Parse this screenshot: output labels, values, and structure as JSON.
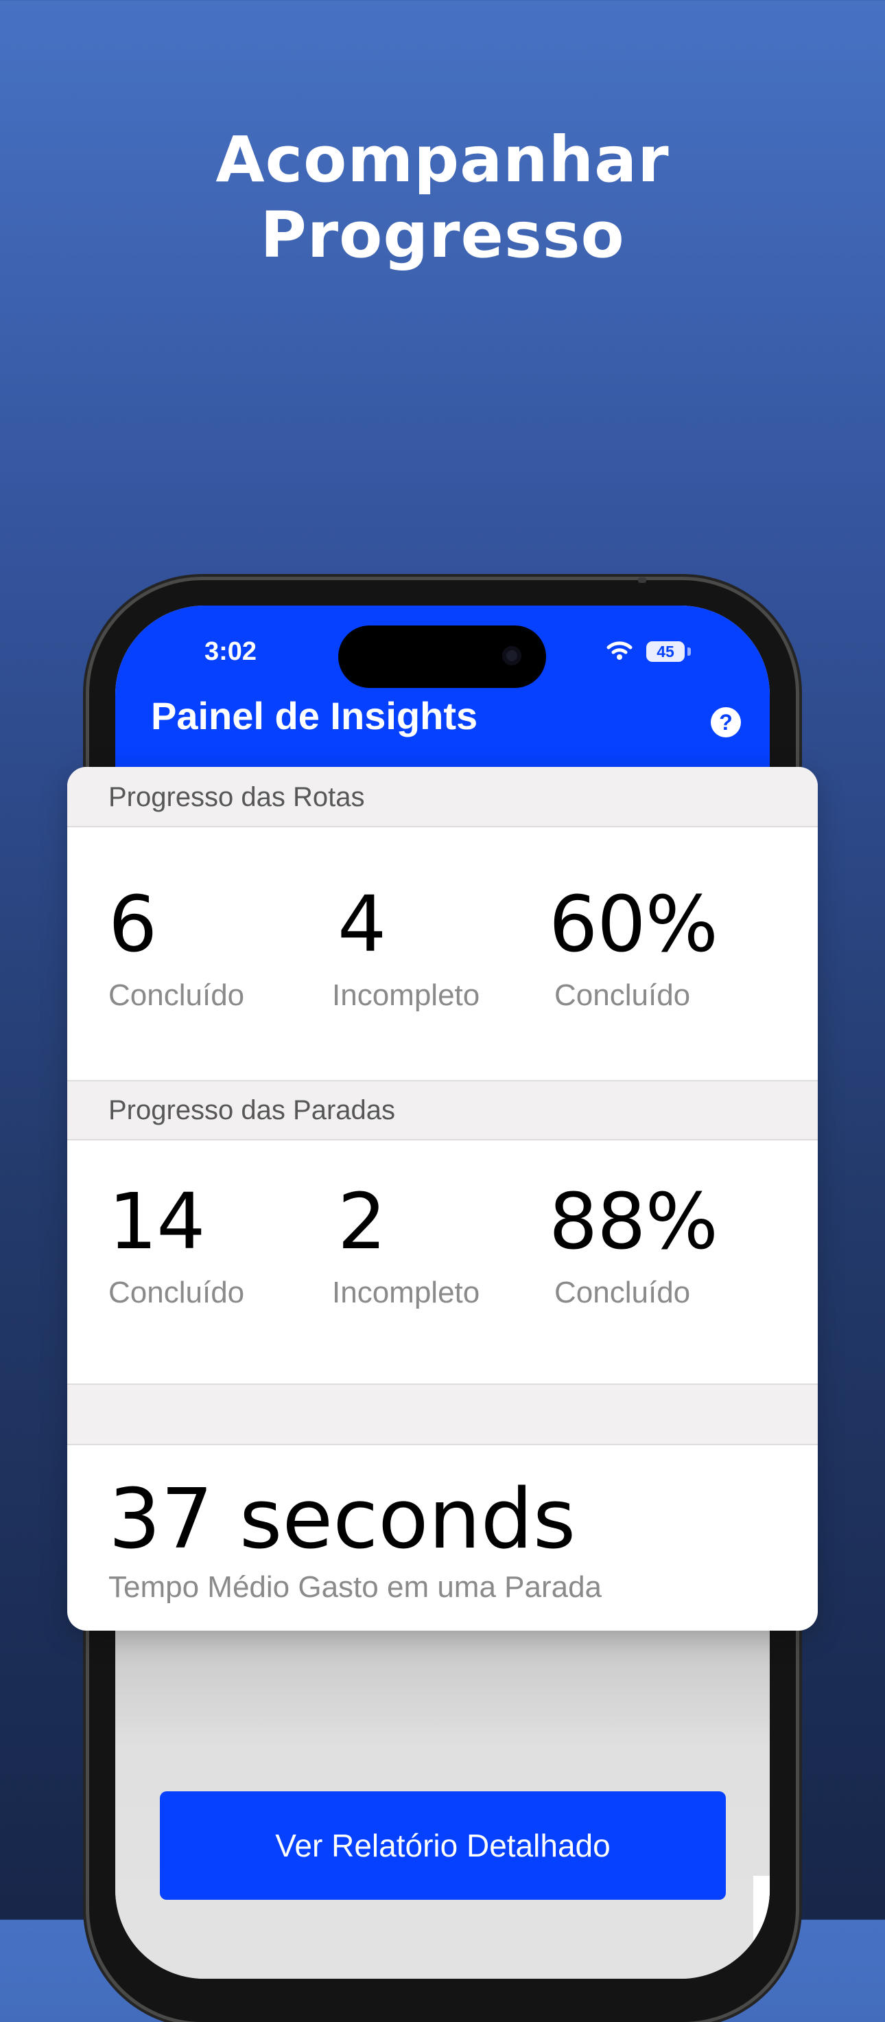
{
  "headline": {
    "line1": "Acompanhar",
    "line2": "Progresso"
  },
  "status_bar": {
    "time": "3:02",
    "battery": "45"
  },
  "nav": {
    "title": "Painel de Insights",
    "help_icon": "?"
  },
  "routes": {
    "header": "Progresso das Rotas",
    "metrics": [
      {
        "value": "6",
        "label": "Concluído"
      },
      {
        "value": "4",
        "label": "Incompleto"
      },
      {
        "value": "60%",
        "label": "Concluído"
      }
    ]
  },
  "stops": {
    "header": "Progresso das Paradas",
    "metrics": [
      {
        "value": "14",
        "label": "Concluído"
      },
      {
        "value": "2",
        "label": "Incompleto"
      },
      {
        "value": "88%",
        "label": "Concluído"
      }
    ]
  },
  "average": {
    "value": "37 seconds",
    "label": "Tempo Médio Gasto em uma Parada"
  },
  "button": {
    "label": "Ver Relatório Detalhado"
  },
  "colors": {
    "brand_blue": "#0641ff",
    "section_header_bg": "#f2f0f1"
  }
}
